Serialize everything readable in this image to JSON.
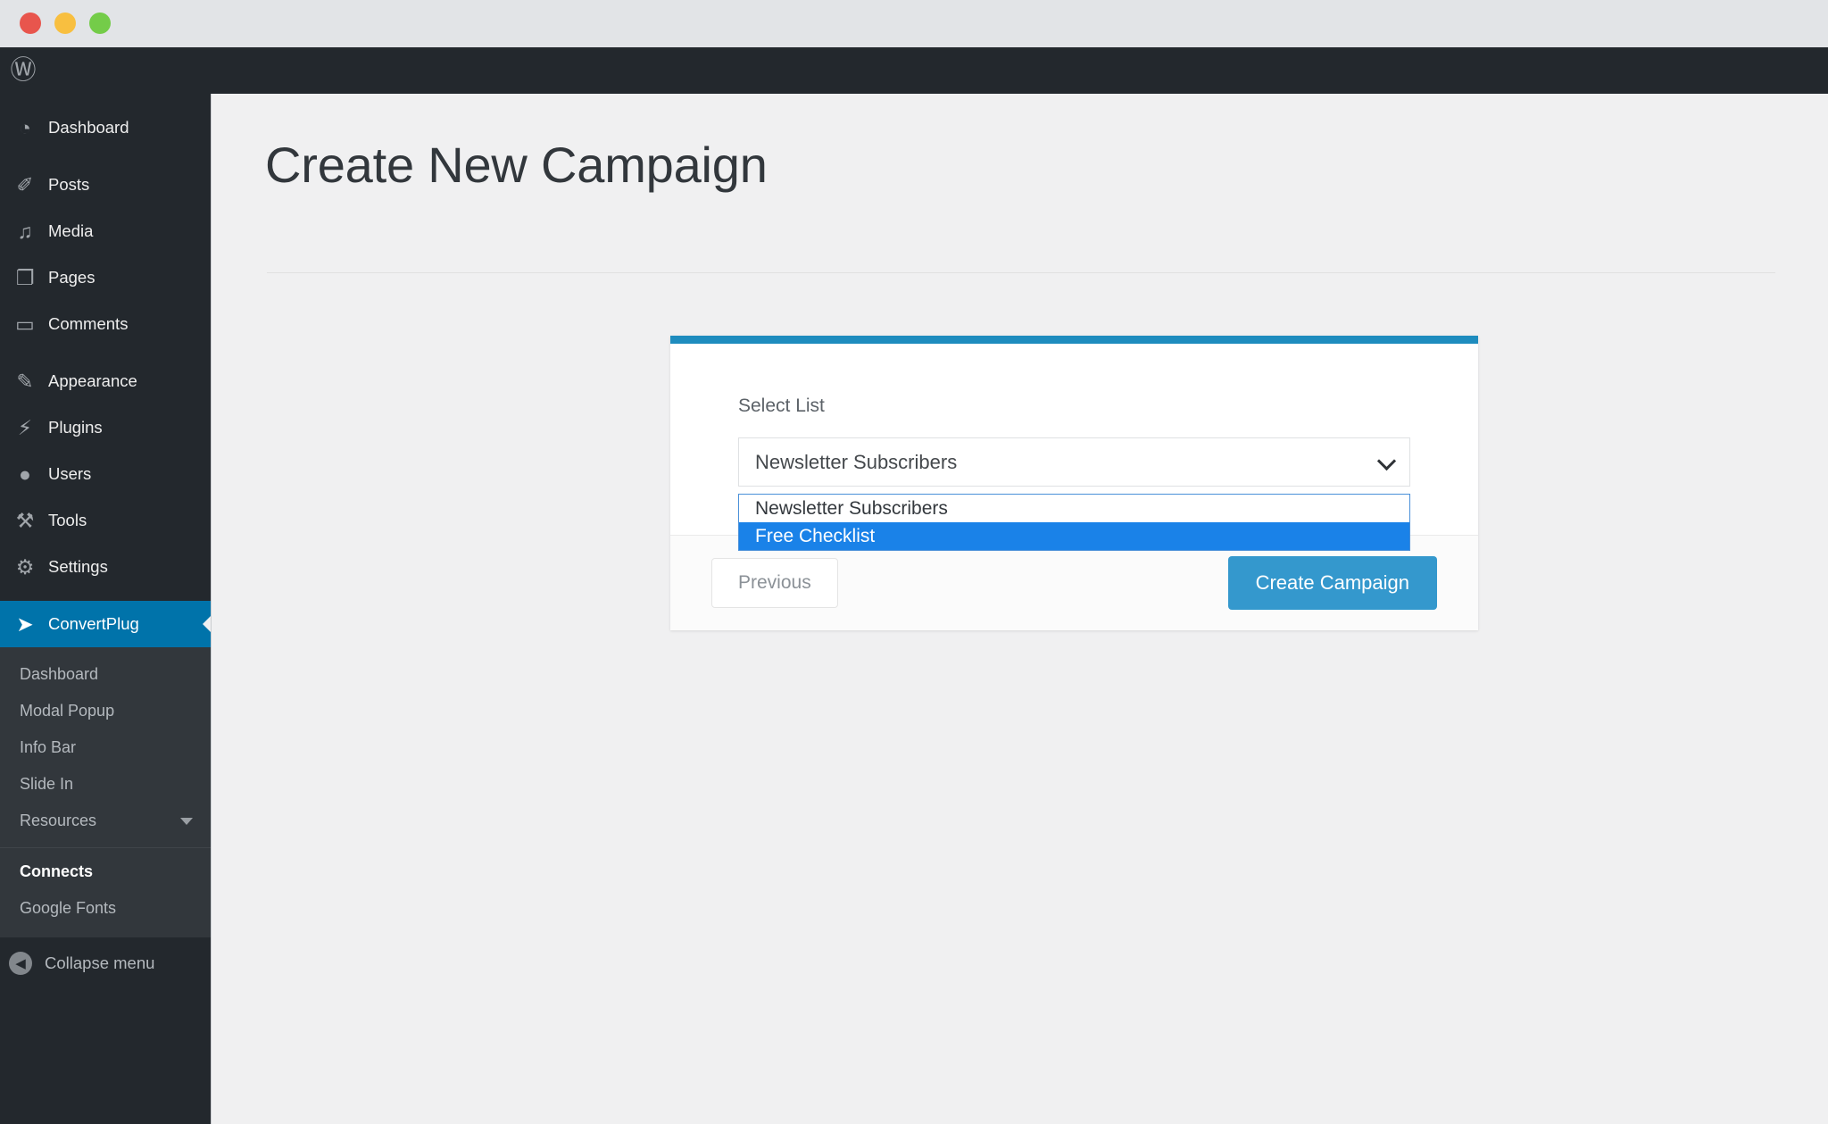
{
  "window": {
    "traffic_lights": [
      {
        "name": "close",
        "color": "#e8554d"
      },
      {
        "name": "minimize",
        "color": "#f8bf40"
      },
      {
        "name": "maximize",
        "color": "#74cc49"
      }
    ]
  },
  "admin_bar": {
    "logo_icon": "wordpress-icon",
    "logo_glyph": "Ⓦ"
  },
  "sidebar": {
    "items": [
      {
        "label": "Dashboard",
        "icon": "dashboard-icon",
        "glyph": "◔",
        "current": false
      },
      {
        "label": "Posts",
        "icon": "pin-icon",
        "glyph": "✐",
        "current": false
      },
      {
        "label": "Media",
        "icon": "media-icon",
        "glyph": "♫",
        "current": false
      },
      {
        "label": "Pages",
        "icon": "pages-icon",
        "glyph": "❐",
        "current": false
      },
      {
        "label": "Comments",
        "icon": "comments-icon",
        "glyph": "▭",
        "current": false
      },
      {
        "label": "Appearance",
        "icon": "brush-icon",
        "glyph": "✎",
        "current": false
      },
      {
        "label": "Plugins",
        "icon": "plug-icon",
        "glyph": "⚡",
        "current": false
      },
      {
        "label": "Users",
        "icon": "user-icon",
        "glyph": "●",
        "current": false
      },
      {
        "label": "Tools",
        "icon": "wrench-icon",
        "glyph": "⚒",
        "current": false
      },
      {
        "label": "Settings",
        "icon": "sliders-icon",
        "glyph": "⚙",
        "current": false
      },
      {
        "label": "ConvertPlug",
        "icon": "convertplug-icon",
        "glyph": "➤",
        "current": true
      }
    ],
    "submenu": [
      {
        "label": "Dashboard",
        "active": false,
        "caret": false
      },
      {
        "label": "Modal Popup",
        "active": false,
        "caret": false
      },
      {
        "label": "Info Bar",
        "active": false,
        "caret": false
      },
      {
        "label": "Slide In",
        "active": false,
        "caret": false
      },
      {
        "label": "Resources",
        "active": false,
        "caret": true
      },
      {
        "label": "Connects",
        "active": true,
        "caret": false
      },
      {
        "label": "Google Fonts",
        "active": false,
        "caret": false
      }
    ],
    "collapse": {
      "label": "Collapse menu",
      "icon": "collapse-arrow-icon",
      "glyph": "◀"
    },
    "highlight_color": "#0073aa",
    "background": "#23282d",
    "submenu_background": "#32373c"
  },
  "page": {
    "title": "Create New Campaign"
  },
  "card": {
    "accent_color": "#1e8cbe",
    "select_label": "Select List",
    "select_value": "Newsletter Subscribers",
    "options": [
      {
        "label": "Newsletter Subscribers",
        "selected": false
      },
      {
        "label": "Free Checklist",
        "selected": true
      }
    ],
    "option_highlight_color": "#1a82e8",
    "previous_label": "Previous",
    "create_label": "Create Campaign",
    "create_color": "#3498cd"
  }
}
